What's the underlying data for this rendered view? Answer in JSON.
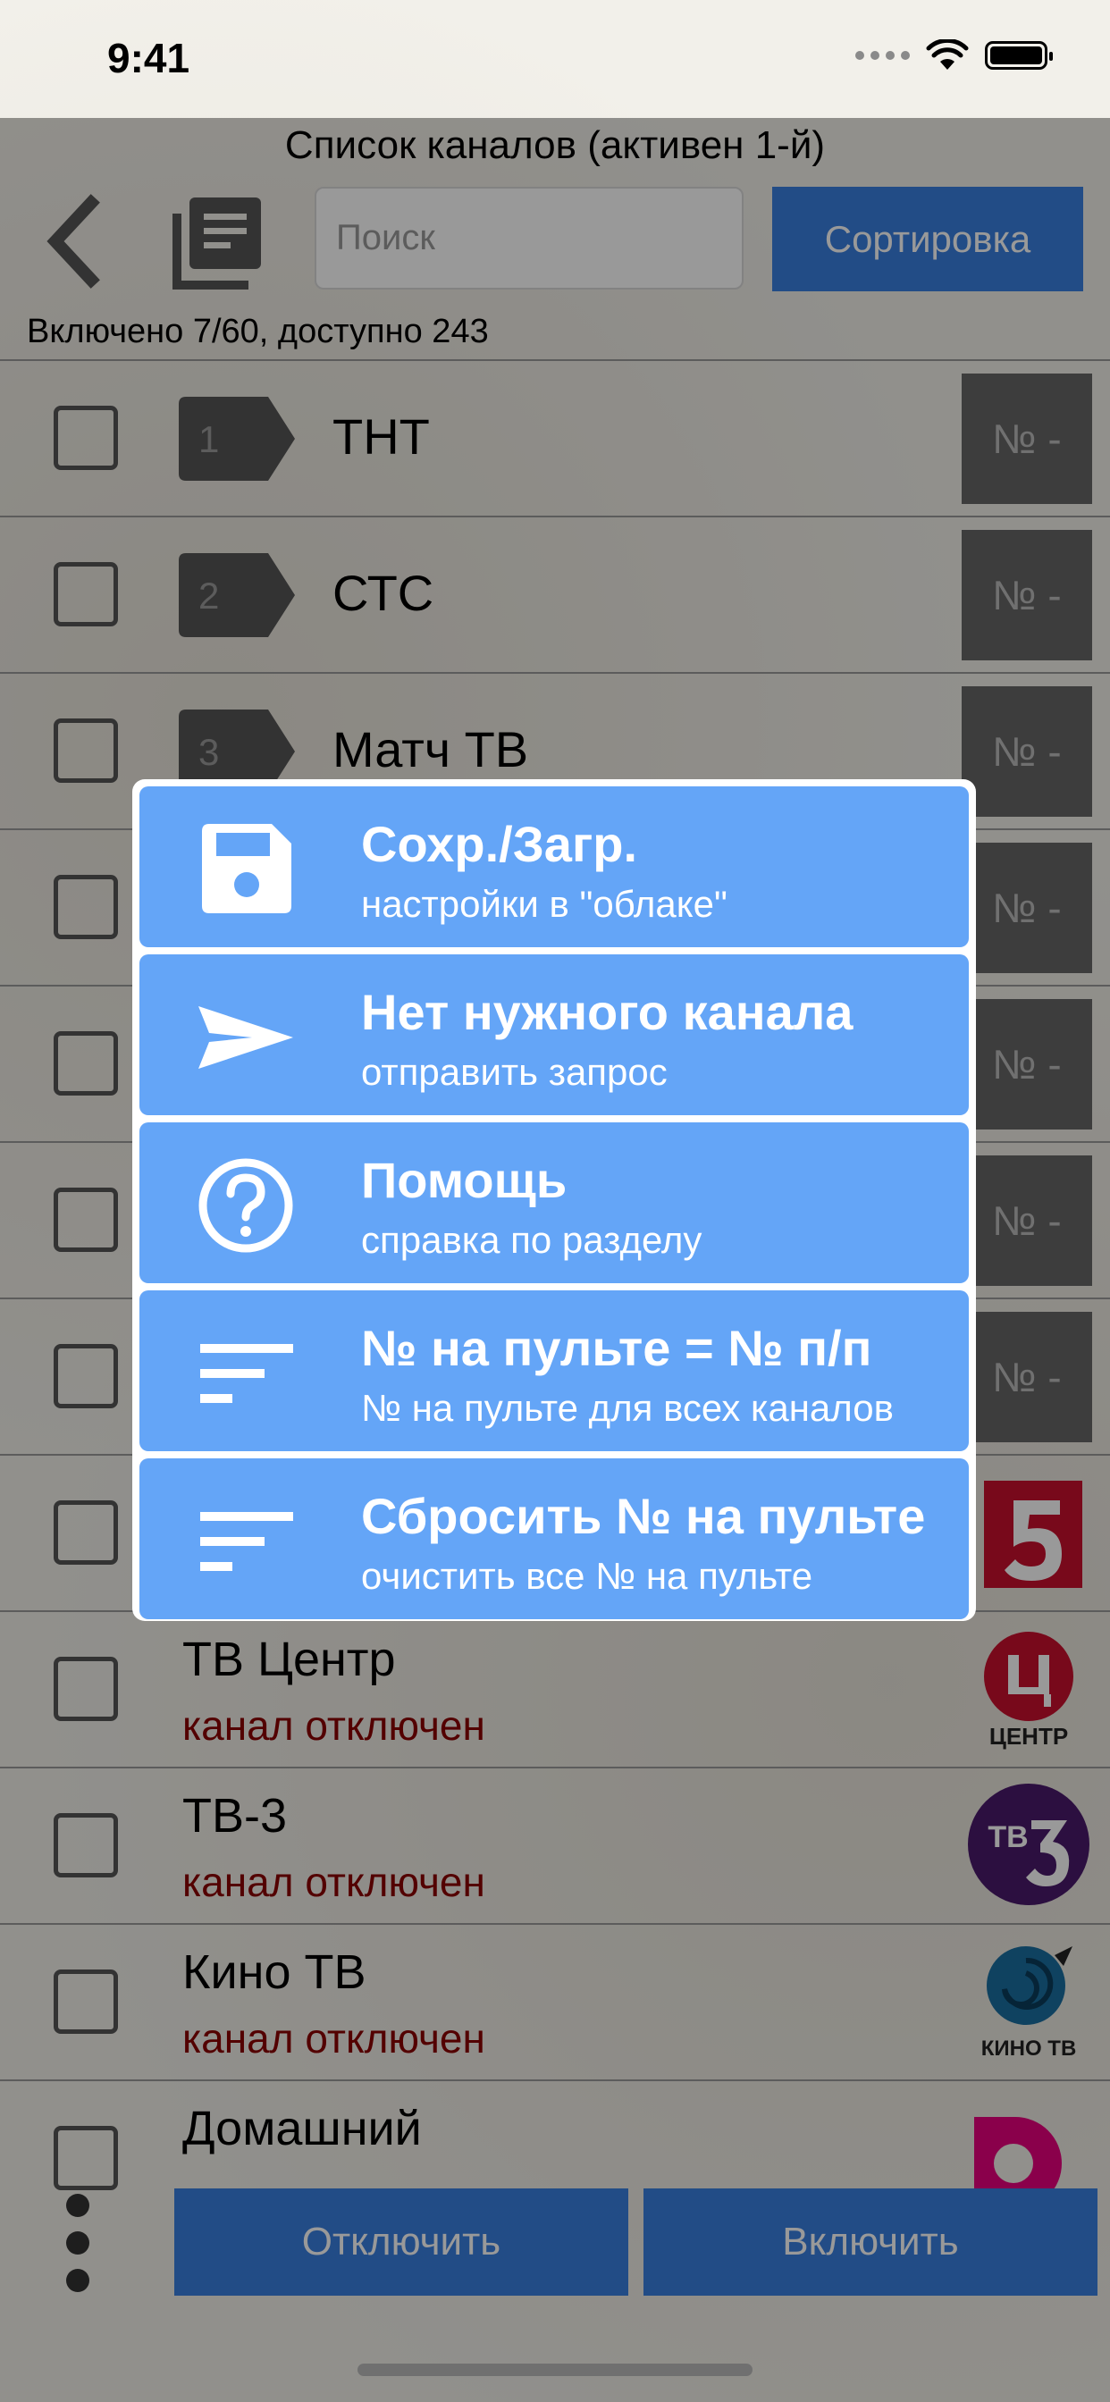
{
  "status_bar": {
    "time": "9:41"
  },
  "header": {
    "title": "Список каналов (активен 1-й)"
  },
  "toolbar": {
    "search_placeholder": "Поиск",
    "sort_label": "Сортировка"
  },
  "counter": "Включено 7/60, доступно 243",
  "channels_enabled": [
    {
      "number": "1",
      "name": "ТНТ",
      "remote": "№ -"
    },
    {
      "number": "2",
      "name": "СТС",
      "remote": "№ -"
    },
    {
      "number": "3",
      "name": "Матч ТВ",
      "remote": "№ -"
    },
    {
      "remote": "№ -"
    },
    {
      "remote": "№ -"
    },
    {
      "remote": "№ -"
    },
    {
      "remote": "№ -"
    }
  ],
  "channels_disabled": [
    {
      "name": "",
      "status": "",
      "logo": "channel-5-logo"
    },
    {
      "name": "ТВ Центр",
      "status": "канал отключен",
      "logo": "tv-centr-logo",
      "logo_text": "ЦЕНТР"
    },
    {
      "name": "ТВ-3",
      "status": "канал отключен",
      "logo": "tv3-logo",
      "logo_text": "ТВ"
    },
    {
      "name": "Кино ТВ",
      "status": "канал отключен",
      "logo": "kino-tv-logo",
      "logo_text": "КИНО ТВ"
    },
    {
      "name": "Домашний",
      "status": "",
      "logo": "domashny-logo"
    }
  ],
  "bottom": {
    "disable_label": "Отключить",
    "enable_label": "Включить"
  },
  "menu": {
    "items": [
      {
        "icon": "floppy-disk-icon",
        "title": "Сохр./Загр.",
        "subtitle": "настройки в \"облаке\""
      },
      {
        "icon": "send-icon",
        "title": "Нет нужного канала",
        "subtitle": "отправить запрос"
      },
      {
        "icon": "help-icon",
        "title": "Помощь",
        "subtitle": "справка по разделу"
      },
      {
        "icon": "sort-icon",
        "title": "№ на пульте = № п/п",
        "subtitle": "№ на пульте для всех каналов"
      },
      {
        "icon": "sort-icon",
        "title": "Сбросить № на пульте",
        "subtitle": "очистить все № на пульте"
      }
    ]
  },
  "colors": {
    "accent": "#3a7fe0",
    "menu_item": "#64a5f7",
    "disabled_text": "#8b0000"
  }
}
